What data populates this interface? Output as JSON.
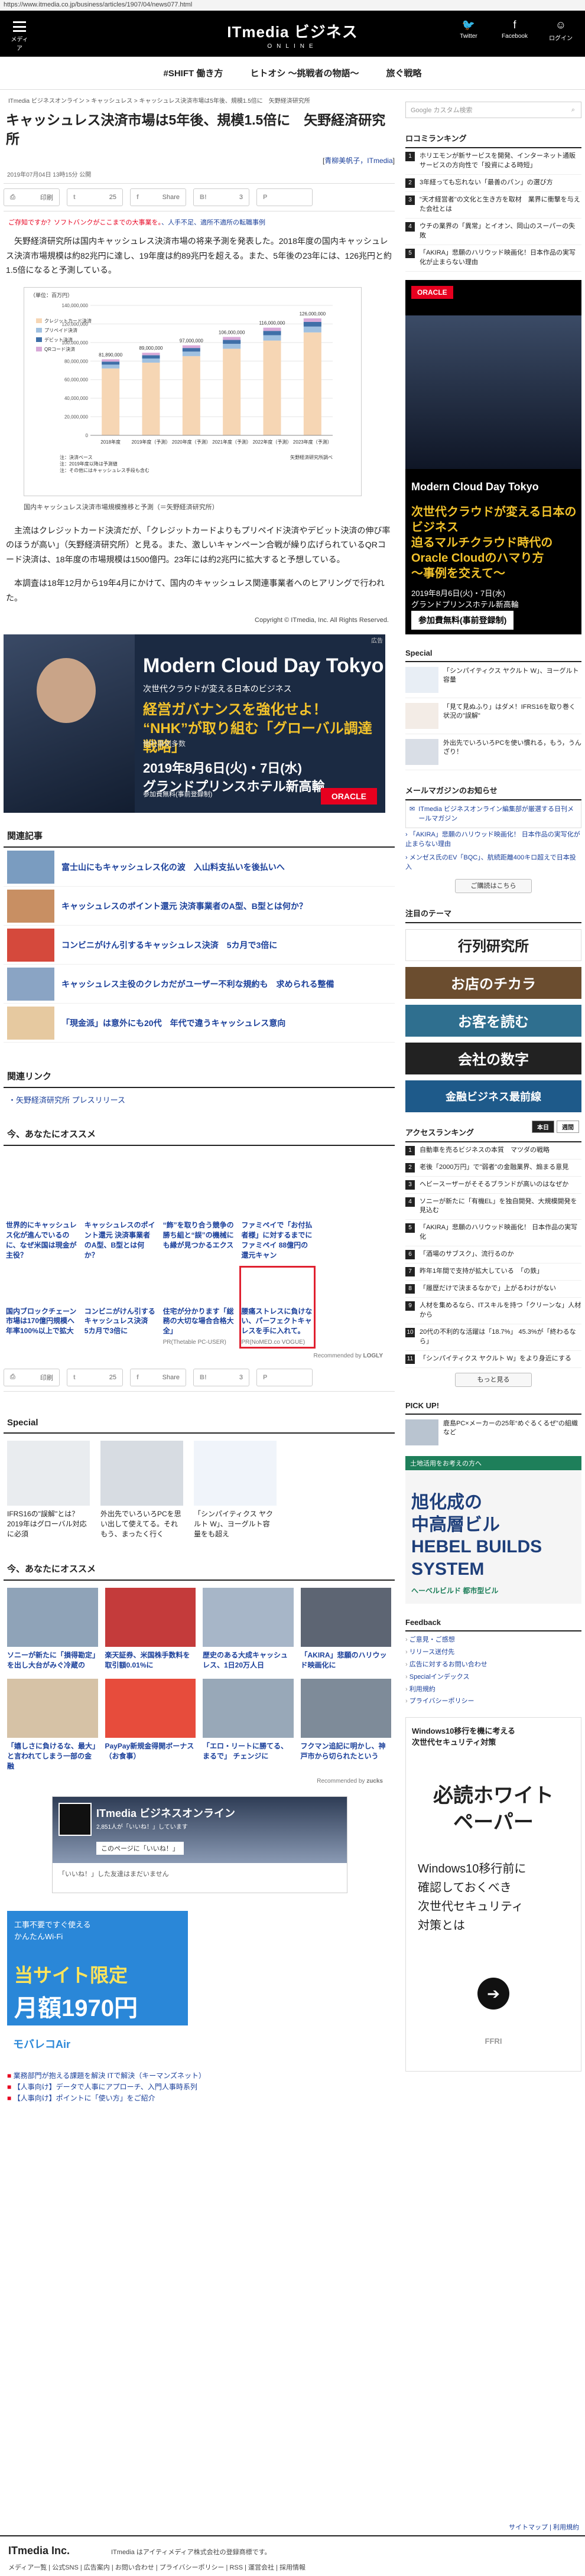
{
  "url": "https://www.itmedia.co.jp/business/articles/1907/04/news077.html",
  "header": {
    "menu_label": "メディア",
    "logo_main": "ITmedia ビジネス",
    "logo_sub": "ONLINE",
    "social": [
      {
        "label": "Twitter"
      },
      {
        "label": "Facebook"
      },
      {
        "label": "ログイン"
      }
    ]
  },
  "subnav": [
    "#SHIFT 働き方",
    "ヒトオシ ～挑戦者の物語～",
    "旅ぐ戦略"
  ],
  "breadcrumb": "ITmedia ビジネスオンライン > キャッシュレス > キャッシュレス決済市場は5年後、規模1.5倍に　矢野経済研究所",
  "article": {
    "title": "キャッシュレス決済市場は5年後、規模1.5倍に　矢野経済研究所",
    "author_prefix": "[",
    "author": "青柳美帆子，ITmedia",
    "author_suffix": "]",
    "date": "2019年07月04日 13時15分 公開",
    "share": [
      {
        "icon": "印刷",
        "count": ""
      },
      {
        "icon": "t",
        "count": "25"
      },
      {
        "icon": "f",
        "count": "Share"
      },
      {
        "icon": "B!",
        "count": "3"
      },
      {
        "icon": "P",
        "count": ""
      }
    ],
    "notice": "ご存知ですか？ソフトバンクがここまでの大事業を。",
    "notice_highlight": "人手不足、適所不適所の転職事例",
    "para1": "矢野経済研究所は国内キャッシュレス決済市場の将来予測を発表した。2018年度の国内キャッシュレス決済市場規模は約82兆円に達し、19年度は約89兆円を超える。また、5年後の23年には、126兆円と約1.5倍になると予測している。",
    "chart_caption": "国内キャッシュレス決済市場規模推移と予測（＝矢野経済研究所）",
    "para2": "主流はクレジットカード決済だが、「クレジットカードよりもプリペイド決済やデビット決済の伸び率のほうが高い」（矢野経済研究所）と見る。また、激しいキャンペーン合戦が繰り広げられているQRコード決済は、18年度の市場規模は1500億円。23年には約2兆円に拡大すると予想している。",
    "para3": "本調査は18年12月から19年4月にかけて、国内のキャッシュレス関連事業者へのヒアリングで行われた。",
    "copyright": "Copyright © ITmedia, Inc. All Rights Reserved."
  },
  "chart_data": {
    "type": "bar",
    "categories": [
      "2018年度",
      "2019年度（予測）",
      "2020年度（予測）",
      "2021年度（予測）",
      "2022年度（予測）",
      "2023年度（予測）"
    ],
    "totals": [
      81890000,
      89000000,
      97000000,
      106000000,
      116000000,
      126000000
    ],
    "total_labels": [
      "81,890,000",
      "89,000,000",
      "97,000,000",
      "106,000,000",
      "116,000,000",
      "126,000,000"
    ],
    "series": [
      {
        "name": "クレジットカード決済",
        "color": "#f6d6b4"
      },
      {
        "name": "プリペイド決済",
        "color": "#9fc0e0"
      },
      {
        "name": "デビット決済",
        "color": "#3f6fa8"
      },
      {
        "name": "QRコード決済",
        "color": "#d8a9d8"
      }
    ],
    "yticks": [
      "0",
      "20,000,000",
      "40,000,000",
      "60,000,000",
      "80,000,000",
      "100,000,000",
      "120,000,000",
      "140,000,000"
    ],
    "ylim": [
      0,
      140000000
    ],
    "unit": "（単位：百万円）",
    "source": "矢野経済研究所調べ",
    "notes": [
      "注：決済ベース",
      "注：2019年度以降は予測値",
      "注：その他にはキャッシュレス手段も含む"
    ]
  },
  "ad_banner": {
    "label": "広告",
    "h1": "Modern Cloud Day Tokyo",
    "h2": "次世代クラウドが変える日本のビジネス",
    "h3": "経営ガバナンスを強化せよ！\n“NHK”が取り組む「グローバル調達戦略」",
    "h4": "他社事例多数",
    "h5": "2019年8月6日(火)・7日(水)\nグランドプリンスホテル新高輪",
    "h6": "参加費無料(事前登録制)",
    "brand": "ORACLE"
  },
  "related": {
    "heading": "関連記事",
    "items": [
      "富士山にもキャッシュレス化の波　入山料支払いを後払いへ",
      "キャッシュレスのポイント還元 決済事業者のA型、B型とは何か？",
      "コンビニがけん引するキャッシュレス決済　5カ月で3倍に",
      "キャッシュレス主役のクレカだがユーザー不利な規約も　求められる整備",
      "「現金派」は意外にも20代　年代で違うキャッシュレス意向"
    ]
  },
  "related_links": {
    "heading": "関連リンク",
    "items": [
      "矢野経済研究所 プレスリリース"
    ]
  },
  "recommend": {
    "heading": "今、あなたにオススメ",
    "items": [
      {
        "title": "世界的にキャッシュレス化が進んでいるのに、なぜ米国は現金が主役？",
        "pr": ""
      },
      {
        "title": "キャッシュレスのポイント還元 決済事業者のA型、B型とは何か？",
        "pr": ""
      },
      {
        "title": "“飾”を取り合う競争の勝ち組と“誤”の機械にも縁が見つかるエクス",
        "pr": ""
      },
      {
        "title": "ファミペイで「お付払者様」に対するまでにファミペイ 88億円の還元キャン",
        "pr": ""
      },
      {
        "title": "",
        "pr": ""
      },
      {
        "title": "国内ブロックチェーン市場は170億円規模へ　年率100%以上で拡大",
        "pr": ""
      },
      {
        "title": "コンビニがけん引するキャッシュレス決済　5カ月で3倍に",
        "pr": ""
      },
      {
        "title": "住宅が分かります「総務の大切な場合合格大全」",
        "pr": "PR(Thetable PC-USER)"
      },
      {
        "title": "腰痛ストレスに負けない、パーフェクトキャレスを手に入れて。",
        "pr": "PR(NoMED.co VOGUE)"
      },
      {
        "title": "",
        "pr": ""
      }
    ],
    "credit": "Recommended by",
    "credit_brand": "LOGLY"
  },
  "special": {
    "heading": "Special",
    "items": [
      "IFRS16の\"誤解\"とは？　2019年はグローバル対応に必須",
      "外出先でいろいろPCを思い出して使えてる。それもう、まったく行く",
      "「シンパイティクス ヤクルト W」、ヨーグルト容量をも超え"
    ]
  },
  "recommend2": {
    "heading": "今、あなたにオススメ",
    "items": [
      "ソニーが新たに「損得勘定」を出し大台がみぐ冷蔵の",
      "楽天証券、米国株手数料を取引額0.01%に",
      "歴史のある大成キャッシュレス、1日20万人日",
      "「AKIRA」悲願のハリウッド映画化に",
      "「嬉しさに負けるな、最大」と言われてしまう一部の金融",
      "PayPay新規金得開ボーナス（お食事）",
      "「エロ・リートに勝てる、まるで」 チェンジに",
      "フクマン追記に明かし、神戸市から切られたという"
    ],
    "credit": "Recommended by",
    "credit_brand": "zucks"
  },
  "fb_card": {
    "name": "ITmedia ビジネスオンライン",
    "meta": "2,851人が「いいね！」しています",
    "btn": "このページに「いいね！」",
    "text": "「いいね！」した友達はまだいません"
  },
  "ad2": {
    "a": "工事不要ですぐ使える\nかんたんWi-Fi",
    "b": "当サイト限定",
    "c": "月額1970円",
    "d": "モバレコAir"
  },
  "text_links": [
    "業務部門が抱える課題を解決 ITで解決（キーマンズネット）",
    "【人事向け】データで人事にアプローチ、入門人事時系列",
    "【人事向け】ポイントに「使い方」をご紹介"
  ],
  "side": {
    "search_placeholder": "Google カスタム検索",
    "ranking_heading": "ロコミランキング",
    "ranking": [
      "ホリエモンが新サービスを開発、インターネット通販サービスの方向性で「投資による時短」",
      "3年経っても忘れない「最善のパン」の選び方",
      "\"天才経営者\"の文化と生き方を取材　業界に衝撃を与えた会社とは",
      "ウチの業界の「異常」とイオン、岡山のスーパーの失敗",
      "「AKIRA」悲願のハリウッド映画化！日本作品の実写化が止まらない理由"
    ],
    "side_ad": {
      "brand": "ORACLE",
      "t": "Modern Cloud Day Tokyo",
      "t2": "次世代クラウドが変える日本のビジネス\n迫るマルチクラウド時代の\nOracle Cloudのハマり方\n～事例を交えて～",
      "t3": "2019年8月6日(火)・7日(水)\nグランドプリンスホテル新高輪",
      "t4": "参加費無料(事前登録制)"
    },
    "special_heading": "Special",
    "special": [
      "「シンパイティクス ヤクルト W」、ヨーグルト容量",
      "「見て見ぬふり」はダメ！IFRS16を取り巻く状況の\"誤解\"",
      "外出先でいろいろPCを使い慣れる，もう，うんざり！"
    ],
    "mail_heading": "メールマガジンのお知らせ",
    "mail": [
      "ITmedia ビジネスオンライン編集部が厳選する日刊メールマガジン",
      "「AKIRA」悲願のハリウッド映画化！ 日本作品の実写化が止まらない理由",
      "メンゼス氏のEV「BQC」、航続距離400キロ超えで日本投入"
    ],
    "mail_btn": "ご購読はこちら",
    "theme_heading": "注目のテーマ",
    "themes": [
      {
        "label": "行列研究所",
        "color": "#ffffff",
        "text": "#222"
      },
      {
        "label": "お店のチカラ",
        "color": "#6b4d2f",
        "text": "#fff"
      },
      {
        "label": "お客を読む",
        "color": "#2f6f8f",
        "text": "#fff"
      },
      {
        "label": "会社の数字",
        "color": "#222",
        "text": "#fff"
      },
      {
        "label": "金融ビジネス最前線",
        "color": "#1e5a8a",
        "text": "#fff"
      }
    ],
    "access_heading": "アクセスランキング",
    "access_tabs": [
      "本日",
      "週間"
    ],
    "access": [
      "自動車を売るビジネスの本質　マツダの戦略",
      "老後「2000万円」で\"弱者\"の金融業界、煽まる意見",
      "ヘビースーザーがそそるブランドが高いのはなぜか",
      "ソニーが新たに「有機EL」を独自開発、大規模開発を見込む",
      "「AKIRA」悲願のハリウッド映画化！ 日本作品の実写化",
      "「酒場のサブスク」、流行るのか",
      "昨年1年間で支持が拡大している　「の鉄」",
      "「履歴だけで決まるなかで」上がるわけがない",
      "人材を集めるなら、ITスキルを持つ「クリーンな」人材から",
      "20代の不利的な活躍は「18.7%」 45.3%が「終わるなら」",
      "「シンパイティクス ヤクルト W」をより身近にする"
    ],
    "more_btn": "もっと見る",
    "pick_heading": "PICK UP!",
    "pick": "鹿島PC×メーカーの25年“めぐるくるぜ”の組織 など",
    "hebel": {
      "top": "土地活用をお考えの方へ",
      "big": "旭化成の\n中高層ビル\nHEBEL BUILDS\nSYSTEM",
      "s": "へーベルビルド 都市型ビル"
    },
    "feedback_heading": "Feedback",
    "feedback": [
      "ご意見・ご感想",
      "リリース送付先",
      "広告に対するお問い合わせ",
      "Specialインデックス",
      "利用規約",
      "プライバシーポリシー"
    ],
    "win_ad": {
      "a": "Windows10移行を機に考える\n次世代セキュリティ対策",
      "b": "必読ホワイト\nペーパー",
      "c": "Windows10移行前に\n確認しておくべき\n次世代セキュリティ\n対策とは",
      "f": "FFRI"
    }
  },
  "sitemap": "サイトマップ | 利用規約",
  "footer": {
    "logo": "ITmedia Inc.",
    "text": "ITmedia はアイティメディア株式会社の登録商標です。",
    "links": "メディア一覧 | 公式SNS | 広告案内 | お問い合わせ | プライバシーポリシー | RSS | 運営会社 | 採用情報"
  }
}
